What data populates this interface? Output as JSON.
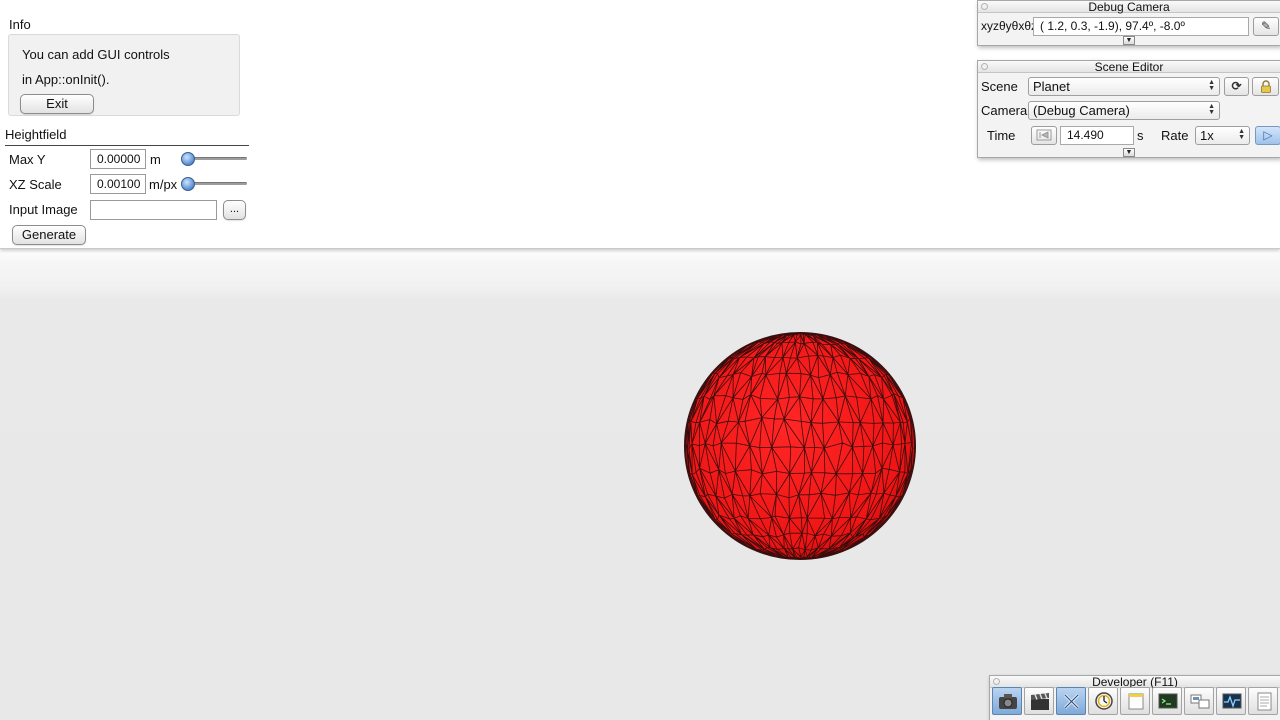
{
  "app_panel": {
    "info": {
      "title": "Info",
      "line1": "You can add GUI controls",
      "line2": "in App::onInit().",
      "exit_label": "Exit"
    },
    "heightfield": {
      "title": "Heightfield",
      "max_y": {
        "label": "Max Y",
        "value": "0.00000",
        "unit": "m",
        "slider_fraction": 0.0
      },
      "xz_scale": {
        "label": "XZ Scale",
        "value": "0.00100",
        "unit": "m/px",
        "slider_fraction": 0.0
      },
      "input_image": {
        "label": "Input Image",
        "value": "",
        "browse_label": "..."
      },
      "generate_label": "Generate"
    }
  },
  "debug_camera": {
    "title": "Debug Camera",
    "label": "xyzθyθxθz",
    "value": "(  1.2,   0.3,  -1.9),  97.4º,  -8.0º"
  },
  "scene_editor": {
    "title": "Scene Editor",
    "scene_label": "Scene",
    "scene_value": "Planet",
    "camera_label": "Camera",
    "camera_value": "(Debug Camera)",
    "time_label": "Time",
    "time_value": "14.490",
    "time_unit": "s",
    "rate_label": "Rate",
    "rate_value": "1x"
  },
  "developer": {
    "title": "Developer (F11)",
    "tools": [
      "camera-icon",
      "clapperboard-icon",
      "tools-icon",
      "clock-icon",
      "window-icon",
      "terminal-icon",
      "network-icon",
      "profiler-icon",
      "document-icon"
    ]
  },
  "scene": {
    "object": "red-wireframe-sphere",
    "color": "#ff1a1a",
    "edge_color": "#2a0808"
  }
}
